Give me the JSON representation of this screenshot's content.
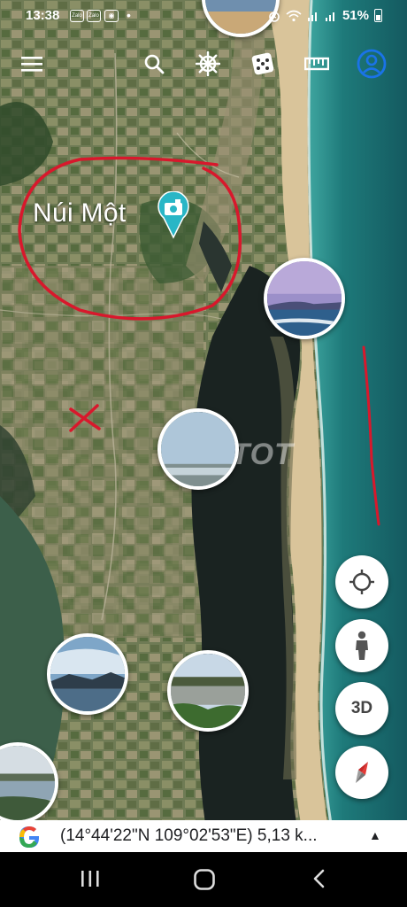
{
  "status_bar": {
    "time": "13:38",
    "notification_icons": [
      "Zalo",
      "Zalo",
      "photo-app-icon"
    ],
    "notification_dot": "•",
    "battery": "51%",
    "system_icons": [
      "alarm-icon",
      "wifi-icon",
      "signal-icon",
      "signal-icon",
      "battery-icon"
    ]
  },
  "toolbar": {
    "menu_icon": "hamburger-menu-icon",
    "search_icon": "search-icon",
    "voyager_icon": "ship-wheel-icon",
    "feeling_lucky_icon": "dice-icon",
    "measure_icon": "ruler-icon",
    "account_icon": "account-circle-icon"
  },
  "map": {
    "place_label": "Núi Một",
    "place_icon": "photo-pin-icon",
    "watermark": "choTOT",
    "annotations": [
      "red-circle",
      "red-x",
      "red-line"
    ]
  },
  "photo_bubbles": [
    {
      "name": "photo-beach-sunset"
    },
    {
      "name": "photo-lagoon-sky"
    },
    {
      "name": "photo-mountain-lake"
    },
    {
      "name": "photo-marsh-field"
    },
    {
      "name": "photo-coastal-bay"
    },
    {
      "name": "photo-top-partial"
    }
  ],
  "controls": {
    "locate_icon": "my-location-icon",
    "pegman_icon": "street-view-pegman-icon",
    "three_d_label": "3D",
    "compass_icon": "compass-icon"
  },
  "info_bar": {
    "logo": "google-g-logo",
    "coordinates": "(14°44'22\"N 109°02'53\"E) 5,13 k...",
    "expand_icon": "▲"
  },
  "nav_bar": {
    "recents_icon": "recents-icon",
    "home_icon": "home-icon",
    "back_icon": "back-icon"
  },
  "colors": {
    "ocean": "#1e6f72",
    "beach": "#d9c49a",
    "river": "#1b2422",
    "land": "#6e7a52",
    "annotation_red": "#d8182c",
    "toolbar_accent": "#1a73e8"
  }
}
